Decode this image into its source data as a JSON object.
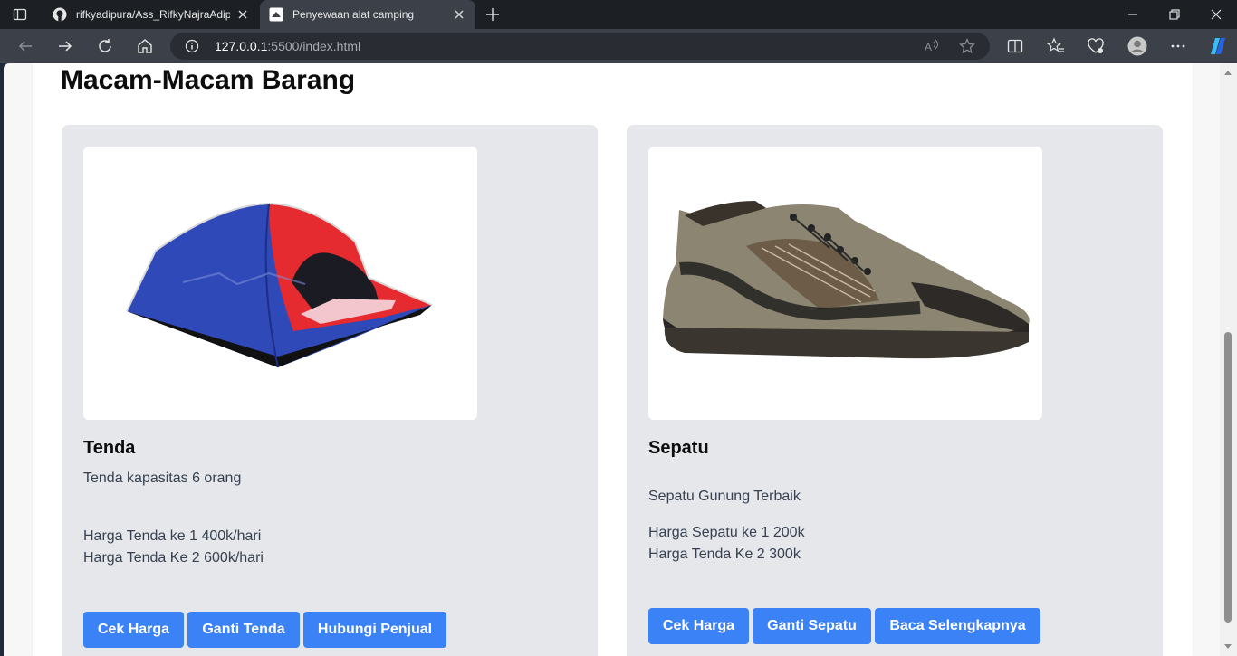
{
  "browser": {
    "tabs": [
      {
        "title": "rifkyadipura/Ass_RifkyNajraAdipura",
        "favicon": "github-icon",
        "active": false
      },
      {
        "title": "Penyewaan alat camping",
        "favicon": "site-icon",
        "active": true
      }
    ],
    "address": {
      "host": "127.0.0.1",
      "rest": ":5500/index.html"
    }
  },
  "page": {
    "section_title": "Macam-Macam Barang",
    "products": [
      {
        "name": "Tenda",
        "description": "Tenda kapasitas 6 orang",
        "price_1": "Harga Tenda ke 1 400k/hari",
        "price_2": "Harga Tenda Ke 2 600k/hari",
        "image": "tent-image",
        "buttons": [
          "Cek Harga",
          "Ganti Tenda",
          "Hubungi Penjual"
        ]
      },
      {
        "name": "Sepatu",
        "description": "Sepatu Gunung Terbaik",
        "price_1": "Harga Sepatu ke 1 200k",
        "price_2": "Harga Tenda Ke 2 300k",
        "image": "shoe-image",
        "buttons": [
          "Cek Harga",
          "Ganti Sepatu",
          "Baca Selengkapnya"
        ]
      }
    ]
  },
  "colors": {
    "button": "#3b82f6",
    "card": "#e5e7eb",
    "tab_active": "#3b4049",
    "tabbar": "#1c1f24"
  }
}
